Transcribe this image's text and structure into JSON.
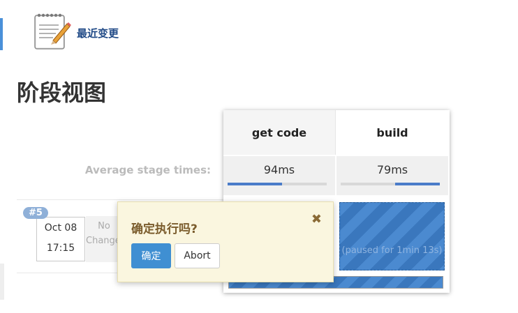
{
  "header": {
    "changes_link": "最近变更",
    "page_title": "阶段视图"
  },
  "stage_view": {
    "stages": [
      {
        "name": "get code",
        "avg_time": "94ms",
        "avg_fraction": 0.5
      },
      {
        "name": "build",
        "avg_time": "79ms",
        "avg_fraction": 0.45
      }
    ],
    "avg_label": "Average stage times:",
    "run": {
      "badge": "#5",
      "date": "Oct 08",
      "time": "17:15",
      "changes_line1": "No",
      "changes_line2": "Changes"
    },
    "paused_text": "(paused for 1min 13s)"
  },
  "confirm": {
    "question": "确定执行吗?",
    "ok_label": "确定",
    "abort_label": "Abort",
    "close_glyph": "✖"
  },
  "colors": {
    "accent": "#3f8fd2",
    "stage_blue": "#4b8ad0",
    "popover_bg": "#faf6df"
  }
}
